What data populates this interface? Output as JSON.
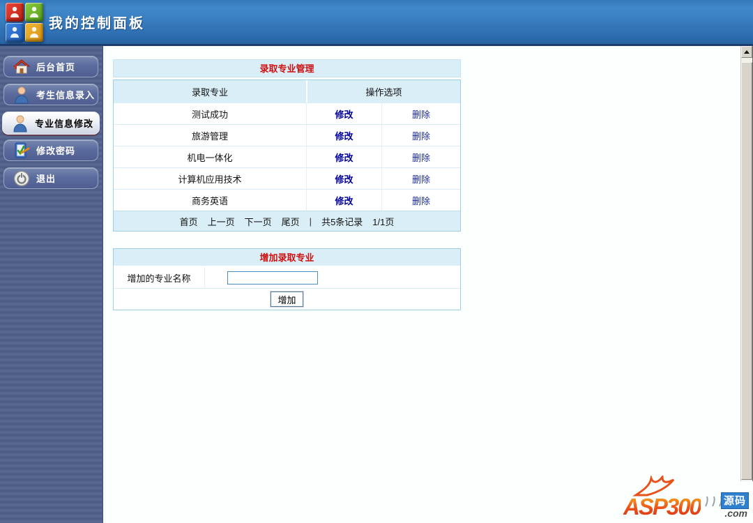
{
  "header": {
    "title": "我的控制面板"
  },
  "sidebar": {
    "items": [
      {
        "key": "home",
        "label": "后台首页",
        "icon": "home-icon",
        "selected": false
      },
      {
        "key": "entry",
        "label": "考生信息录入",
        "icon": "person-icon",
        "selected": false
      },
      {
        "key": "major",
        "label": "专业信息修改",
        "icon": "person-icon",
        "selected": true
      },
      {
        "key": "password",
        "label": "修改密码",
        "icon": "password-icon",
        "selected": false
      },
      {
        "key": "exit",
        "label": "退出",
        "icon": "logout-icon",
        "selected": false
      }
    ]
  },
  "major_table": {
    "title": "录取专业管理",
    "columns": [
      "录取专业",
      "操作选项"
    ],
    "rows": [
      {
        "name": "测试成功",
        "edit": "修改",
        "delete": "删除"
      },
      {
        "name": "旅游管理",
        "edit": "修改",
        "delete": "删除"
      },
      {
        "name": "机电一体化",
        "edit": "修改",
        "delete": "删除"
      },
      {
        "name": "计算机应用技术",
        "edit": "修改",
        "delete": "删除"
      },
      {
        "name": "商务英语",
        "edit": "修改",
        "delete": "删除"
      }
    ],
    "pagination": {
      "links": [
        "首页",
        "上一页",
        "下一页",
        "尾页"
      ],
      "separator": "|",
      "record_count": "共5条记录",
      "page_info": "1/1页"
    }
  },
  "add_form": {
    "title": "增加录取专业",
    "field_label": "增加的专业名称",
    "input_value": "",
    "submit_label": "增加"
  },
  "watermark": {
    "brand": "ASP300",
    "suffix": ".com",
    "badge": "源码"
  },
  "colors": {
    "header_blue": "#3a80c2",
    "sidebar_blue": "#52628c",
    "panel_band_bg": "#d9eef6",
    "table_border": "#9fcfe2",
    "panel_title_red": "#d01010",
    "link_navy": "#1c2d9c",
    "edit_link_blue": "#00009a",
    "brand_orange": "#e8521a",
    "badge_blue": "#2f80cf"
  }
}
